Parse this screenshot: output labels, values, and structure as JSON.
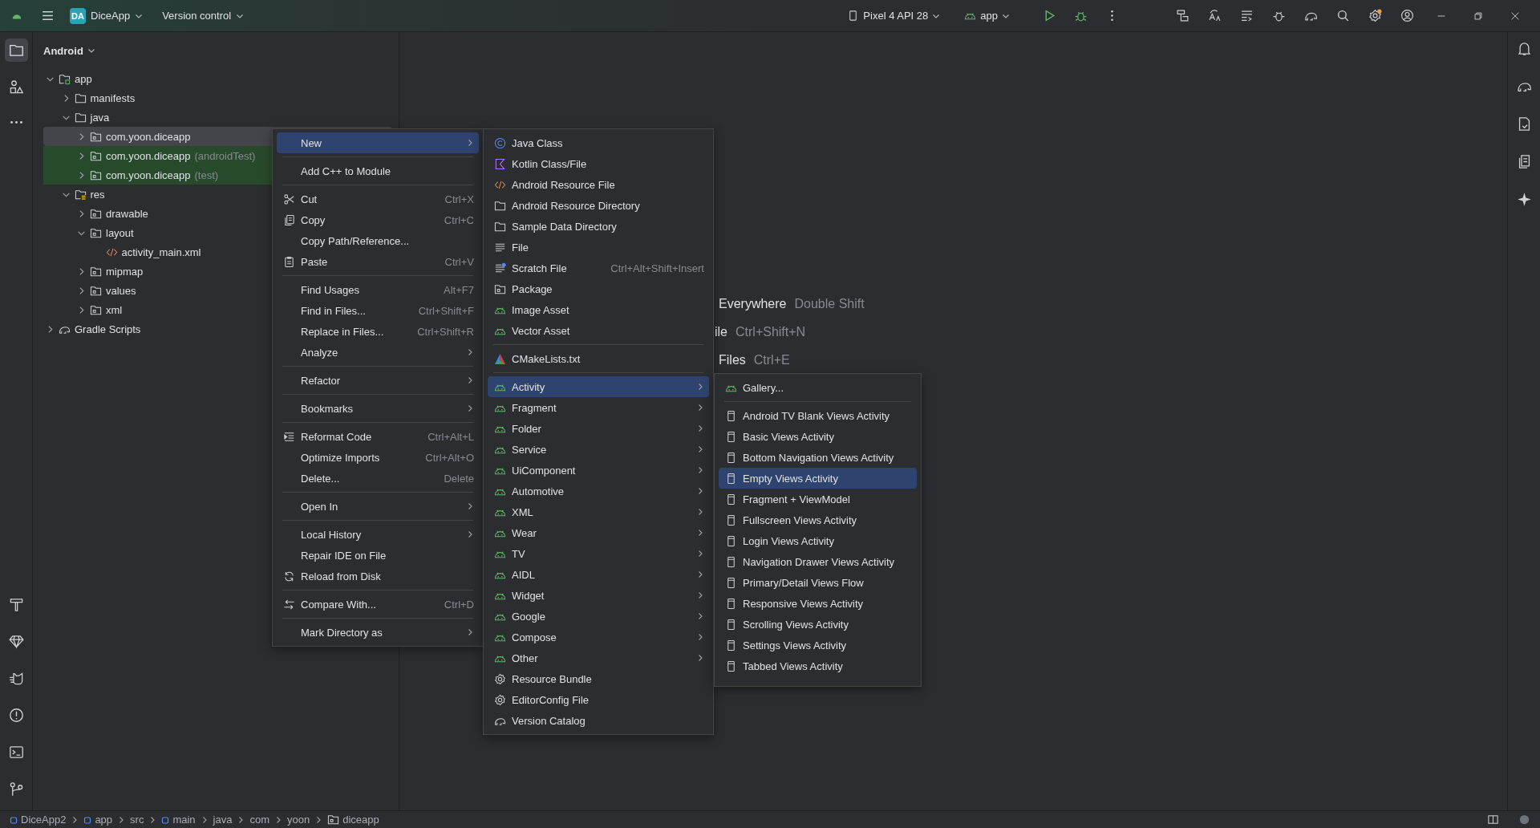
{
  "top_bar": {
    "project_badge": "DA",
    "project": "DiceApp",
    "vcs": "Version control",
    "device": "Pixel 4 API 28",
    "run_config": "app",
    "settings_update": true
  },
  "tool_window": {
    "title": "Android"
  },
  "tree": [
    {
      "label": "app",
      "kind": "module",
      "expanded": true,
      "selected": false,
      "test": false,
      "children": [
        {
          "label": "manifests",
          "kind": "folder",
          "expanded": false,
          "selected": false,
          "test": false
        },
        {
          "label": "java",
          "kind": "folder",
          "expanded": true,
          "selected": false,
          "test": false,
          "children": [
            {
              "label": "com.yoon.diceapp",
              "kind": "package",
              "expanded": false,
              "selected": true,
              "test": false
            },
            {
              "label": "com.yoon.diceapp",
              "suffix": "(androidTest)",
              "kind": "package",
              "expanded": false,
              "selected": false,
              "test": true
            },
            {
              "label": "com.yoon.diceapp",
              "suffix": "(test)",
              "kind": "package",
              "expanded": false,
              "selected": false,
              "test": true
            }
          ]
        },
        {
          "label": "res",
          "kind": "res",
          "expanded": true,
          "selected": false,
          "test": false,
          "children": [
            {
              "label": "drawable",
              "kind": "package",
              "expanded": false,
              "selected": false,
              "test": false
            },
            {
              "label": "layout",
              "kind": "package",
              "expanded": true,
              "selected": false,
              "test": false,
              "children": [
                {
                  "label": "activity_main.xml",
                  "kind": "xml",
                  "selected": false,
                  "test": false
                }
              ]
            },
            {
              "label": "mipmap",
              "kind": "package",
              "expanded": false,
              "selected": false,
              "test": false
            },
            {
              "label": "values",
              "kind": "package",
              "expanded": false,
              "selected": false,
              "test": false
            },
            {
              "label": "xml",
              "kind": "package",
              "expanded": false,
              "selected": false,
              "test": false
            }
          ]
        }
      ]
    },
    {
      "label": "Gradle Scripts",
      "kind": "gradle",
      "expanded": false,
      "selected": false,
      "test": false
    }
  ],
  "editor_hints": [
    {
      "action": "Everywhere",
      "shortcut": "Double Shift"
    },
    {
      "action": "ile",
      "shortcut": "Ctrl+Shift+N"
    },
    {
      "action": "Files",
      "shortcut": "Ctrl+E"
    }
  ],
  "context_menu": [
    {
      "kind": "plain",
      "label": "New",
      "submenu": true,
      "selected": true
    },
    {
      "kind": "separator"
    },
    {
      "kind": "plain",
      "label": "Add C++ to Module",
      "submenu": false,
      "selected": false
    },
    {
      "kind": "separator"
    },
    {
      "kind": "cut",
      "label": "Cut",
      "shortcut": "Ctrl+X",
      "submenu": false,
      "selected": false
    },
    {
      "kind": "copy",
      "label": "Copy",
      "shortcut": "Ctrl+C",
      "submenu": false,
      "selected": false
    },
    {
      "kind": "plain",
      "label": "Copy Path/Reference...",
      "submenu": false,
      "selected": false
    },
    {
      "kind": "paste",
      "label": "Paste",
      "shortcut": "Ctrl+V",
      "submenu": false,
      "selected": false
    },
    {
      "kind": "separator"
    },
    {
      "kind": "plain",
      "label": "Find Usages",
      "shortcut": "Alt+F7",
      "submenu": false,
      "selected": false
    },
    {
      "kind": "plain",
      "label": "Find in Files...",
      "shortcut": "Ctrl+Shift+F",
      "submenu": false,
      "selected": false
    },
    {
      "kind": "plain",
      "label": "Replace in Files...",
      "shortcut": "Ctrl+Shift+R",
      "submenu": false,
      "selected": false
    },
    {
      "kind": "plain",
      "label": "Analyze",
      "submenu": true,
      "selected": false
    },
    {
      "kind": "separator"
    },
    {
      "kind": "plain",
      "label": "Refactor",
      "submenu": true,
      "selected": false
    },
    {
      "kind": "separator"
    },
    {
      "kind": "plain",
      "label": "Bookmarks",
      "submenu": true,
      "selected": false
    },
    {
      "kind": "separator"
    },
    {
      "kind": "reformat",
      "label": "Reformat Code",
      "shortcut": "Ctrl+Alt+L",
      "submenu": false,
      "selected": false
    },
    {
      "kind": "plain",
      "label": "Optimize Imports",
      "shortcut": "Ctrl+Alt+O",
      "submenu": false,
      "selected": false
    },
    {
      "kind": "plain",
      "label": "Delete...",
      "shortcut": "Delete",
      "submenu": false,
      "selected": false
    },
    {
      "kind": "separator"
    },
    {
      "kind": "plain",
      "label": "Open In",
      "submenu": true,
      "selected": false
    },
    {
      "kind": "separator"
    },
    {
      "kind": "plain",
      "label": "Local History",
      "submenu": true,
      "selected": false
    },
    {
      "kind": "plain",
      "label": "Repair IDE on File",
      "submenu": false,
      "selected": false
    },
    {
      "kind": "reload",
      "label": "Reload from Disk",
      "submenu": false,
      "selected": false
    },
    {
      "kind": "separator"
    },
    {
      "kind": "compare",
      "label": "Compare With...",
      "shortcut": "Ctrl+D",
      "submenu": false,
      "selected": false
    },
    {
      "kind": "separator"
    },
    {
      "kind": "plain",
      "label": "Mark Directory as",
      "submenu": true,
      "selected": false
    }
  ],
  "new_menu": [
    {
      "kind": "java",
      "label": "Java Class",
      "submenu": false,
      "selected": false
    },
    {
      "kind": "kotlin",
      "label": "Kotlin Class/File",
      "submenu": false,
      "selected": false
    },
    {
      "kind": "xml",
      "label": "Android Resource File",
      "submenu": false,
      "selected": false
    },
    {
      "kind": "folder",
      "label": "Android Resource Directory",
      "submenu": false,
      "selected": false
    },
    {
      "kind": "folder",
      "label": "Sample Data Directory",
      "submenu": false,
      "selected": false
    },
    {
      "kind": "file",
      "label": "File",
      "submenu": false,
      "selected": false
    },
    {
      "kind": "scratch",
      "label": "Scratch File",
      "shortcut": "Ctrl+Alt+Shift+Insert",
      "submenu": false,
      "selected": false
    },
    {
      "kind": "package",
      "label": "Package",
      "submenu": false,
      "selected": false
    },
    {
      "kind": "android",
      "label": "Image Asset",
      "submenu": false,
      "selected": false
    },
    {
      "kind": "android",
      "label": "Vector Asset",
      "submenu": false,
      "selected": false
    },
    {
      "kind": "separator"
    },
    {
      "kind": "cmake",
      "label": "CMakeLists.txt",
      "submenu": false,
      "selected": false
    },
    {
      "kind": "separator"
    },
    {
      "kind": "android",
      "label": "Activity",
      "submenu": true,
      "selected": true
    },
    {
      "kind": "android",
      "label": "Fragment",
      "submenu": true,
      "selected": false
    },
    {
      "kind": "android",
      "label": "Folder",
      "submenu": true,
      "selected": false
    },
    {
      "kind": "android",
      "label": "Service",
      "submenu": true,
      "selected": false
    },
    {
      "kind": "android",
      "label": "UiComponent",
      "submenu": true,
      "selected": false
    },
    {
      "kind": "android",
      "label": "Automotive",
      "submenu": true,
      "selected": false
    },
    {
      "kind": "android",
      "label": "XML",
      "submenu": true,
      "selected": false
    },
    {
      "kind": "android",
      "label": "Wear",
      "submenu": true,
      "selected": false
    },
    {
      "kind": "android",
      "label": "TV",
      "submenu": true,
      "selected": false
    },
    {
      "kind": "android",
      "label": "AIDL",
      "submenu": true,
      "selected": false
    },
    {
      "kind": "android",
      "label": "Widget",
      "submenu": true,
      "selected": false
    },
    {
      "kind": "android",
      "label": "Google",
      "submenu": true,
      "selected": false
    },
    {
      "kind": "android",
      "label": "Compose",
      "submenu": true,
      "selected": false
    },
    {
      "kind": "android",
      "label": "Other",
      "submenu": true,
      "selected": false
    },
    {
      "kind": "gear",
      "label": "Resource Bundle",
      "submenu": false,
      "selected": false
    },
    {
      "kind": "gear",
      "label": "EditorConfig File",
      "submenu": false,
      "selected": false
    },
    {
      "kind": "catalog",
      "label": "Version Catalog",
      "submenu": false,
      "selected": false
    }
  ],
  "activity_menu": [
    {
      "kind": "android",
      "label": "Gallery...",
      "submenu": false,
      "selected": false
    },
    {
      "kind": "separator"
    },
    {
      "kind": "phone",
      "label": "Android TV Blank Views Activity",
      "submenu": false,
      "selected": false
    },
    {
      "kind": "phone",
      "label": "Basic Views Activity",
      "submenu": false,
      "selected": false
    },
    {
      "kind": "phone",
      "label": "Bottom Navigation Views Activity",
      "submenu": false,
      "selected": false
    },
    {
      "kind": "phone",
      "label": "Empty Views Activity",
      "submenu": false,
      "selected": true
    },
    {
      "kind": "phone",
      "label": "Fragment + ViewModel",
      "submenu": false,
      "selected": false
    },
    {
      "kind": "phone",
      "label": "Fullscreen Views Activity",
      "submenu": false,
      "selected": false
    },
    {
      "kind": "phone",
      "label": "Login Views Activity",
      "submenu": false,
      "selected": false
    },
    {
      "kind": "phone",
      "label": "Navigation Drawer Views Activity",
      "submenu": false,
      "selected": false
    },
    {
      "kind": "phone",
      "label": "Primary/Detail Views Flow",
      "submenu": false,
      "selected": false
    },
    {
      "kind": "phone",
      "label": "Responsive Views Activity",
      "submenu": false,
      "selected": false
    },
    {
      "kind": "phone",
      "label": "Scrolling Views Activity",
      "submenu": false,
      "selected": false
    },
    {
      "kind": "phone",
      "label": "Settings Views Activity",
      "submenu": false,
      "selected": false
    },
    {
      "kind": "phone",
      "label": "Tabbed Views Activity",
      "submenu": false,
      "selected": false
    }
  ],
  "breadcrumb": [
    {
      "label": "DiceApp2",
      "kind": "module"
    },
    {
      "label": "app",
      "kind": "module"
    },
    {
      "label": "src",
      "kind": "plain"
    },
    {
      "label": "main",
      "kind": "module"
    },
    {
      "label": "java",
      "kind": "plain"
    },
    {
      "label": "com",
      "kind": "plain"
    },
    {
      "label": "yoon",
      "kind": "plain"
    },
    {
      "label": "diceapp",
      "kind": "package"
    }
  ]
}
